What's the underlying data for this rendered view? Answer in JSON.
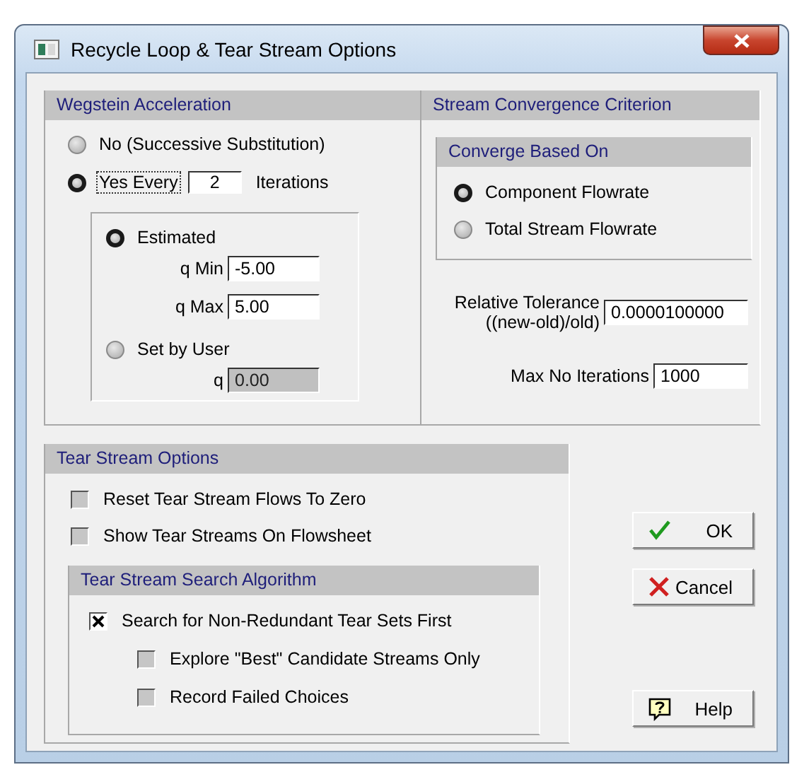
{
  "window": {
    "title": "Recycle Loop & Tear Stream Options"
  },
  "wegstein": {
    "title": "Wegstein Acceleration",
    "options": [
      {
        "label": "No (Successive Substitution)",
        "selected": false
      },
      {
        "label": "Yes Every",
        "value": "2",
        "suffix": "Iterations",
        "selected": true
      }
    ],
    "method": [
      {
        "label": "Estimated",
        "selected": true,
        "fields": [
          {
            "label": "q Min",
            "value": "-5.00",
            "disabled": false
          },
          {
            "label": "q Max",
            "value": "5.00",
            "disabled": false
          }
        ]
      },
      {
        "label": "Set by User",
        "selected": false,
        "fields": [
          {
            "label": "q",
            "value": "0.00",
            "disabled": true
          }
        ]
      }
    ]
  },
  "convergence": {
    "title": "Stream Convergence Criterion",
    "based_on": {
      "title": "Converge Based On",
      "options": [
        {
          "label": "Component Flowrate",
          "selected": true
        },
        {
          "label": "Total Stream Flowrate",
          "selected": false
        }
      ]
    },
    "fields": [
      {
        "label": "Relative Tolerance",
        "sublabel": "((new-old)/old)",
        "value": "0.0000100000"
      },
      {
        "label": "Max No Iterations",
        "value": "1000"
      }
    ]
  },
  "tear_stream": {
    "title": "Tear Stream Options",
    "checkboxes": [
      {
        "label": "Reset Tear Stream Flows To Zero",
        "checked": false
      },
      {
        "label": "Show Tear Streams On Flowsheet",
        "checked": false
      }
    ],
    "search": {
      "title": "Tear Stream Search Algorithm",
      "checkboxes": [
        {
          "label": "Search for Non-Redundant Tear Sets First",
          "checked": true,
          "children": [
            {
              "label": "Explore \"Best\" Candidate Streams Only",
              "checked": false
            },
            {
              "label": "Record Failed Choices",
              "checked": false
            }
          ]
        }
      ]
    }
  },
  "buttons": [
    {
      "label": "OK",
      "kind": "ok"
    },
    {
      "label": "Cancel",
      "kind": "cancel"
    },
    {
      "label": "Help",
      "kind": "help"
    }
  ]
}
